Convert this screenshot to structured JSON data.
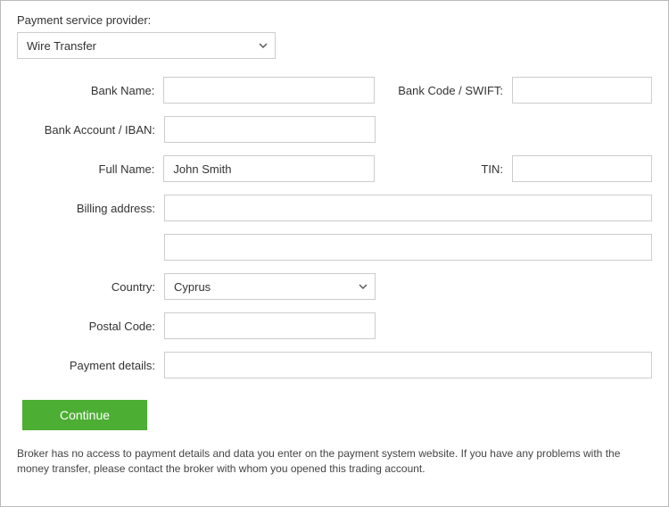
{
  "header": {
    "provider_label": "Payment service provider:",
    "provider_value": "Wire Transfer"
  },
  "fields": {
    "bank_name_label": "Bank Name:",
    "bank_name_value": "",
    "bank_code_label": "Bank Code / SWIFT:",
    "bank_code_value": "",
    "bank_account_label": "Bank Account / IBAN:",
    "bank_account_value": "",
    "full_name_label": "Full Name:",
    "full_name_value": "John Smith",
    "tin_label": "TIN:",
    "tin_value": "",
    "billing_address_label": "Billing address:",
    "billing_address_value": "",
    "billing_address2_value": "",
    "country_label": "Country:",
    "country_value": "Cyprus",
    "postal_code_label": "Postal Code:",
    "postal_code_value": "",
    "payment_details_label": "Payment details:",
    "payment_details_value": ""
  },
  "buttons": {
    "continue": "Continue"
  },
  "disclaimer": "Broker has no access to payment details and data you enter on the payment system website. If you have any problems with the money transfer, please contact the broker with whom you opened this trading account."
}
